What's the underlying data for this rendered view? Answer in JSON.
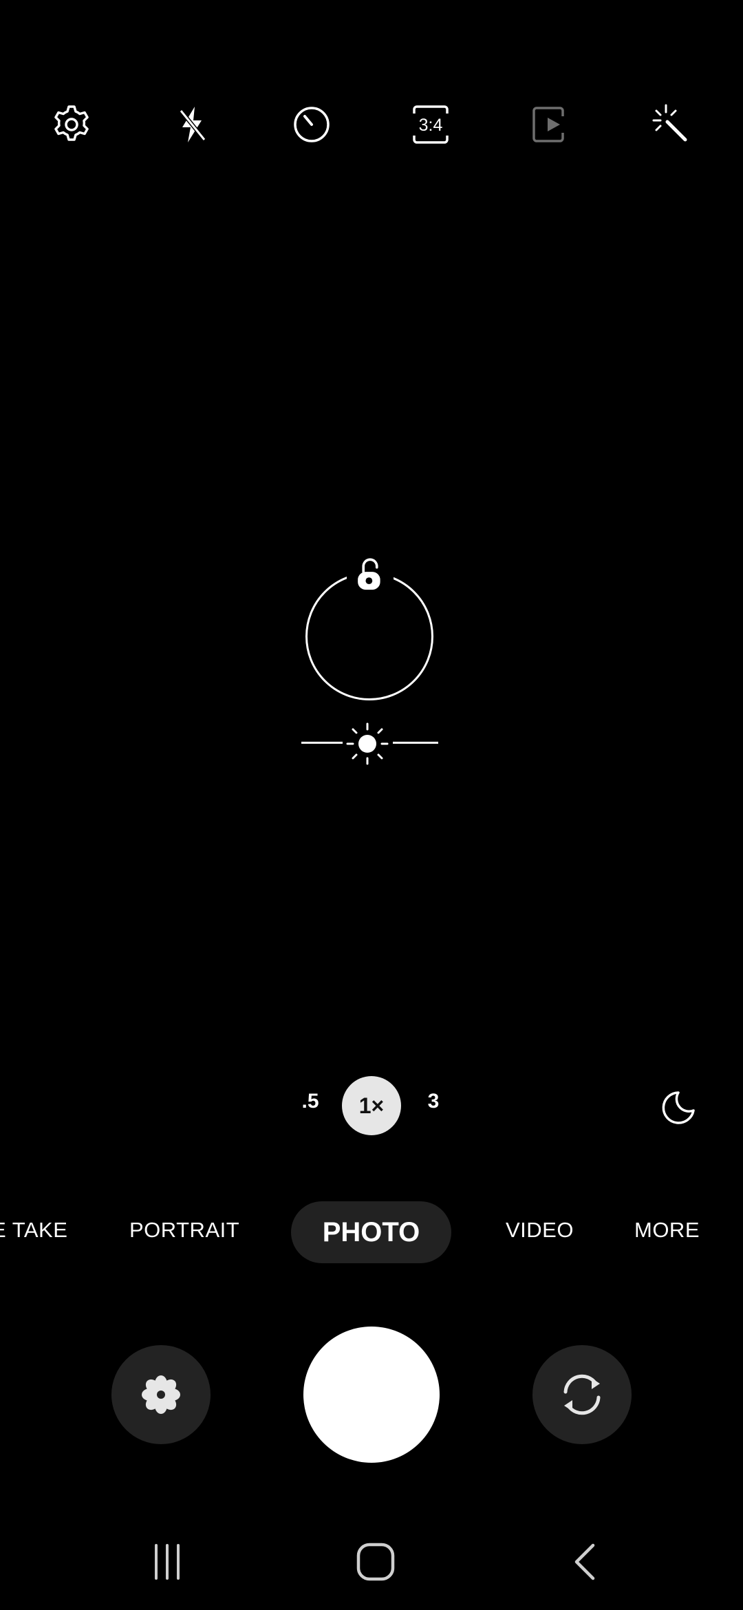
{
  "toolbar": {
    "icons": [
      "settings-icon",
      "flash-off-icon",
      "timer-icon",
      "aspect-ratio-icon",
      "motion-photo-icon",
      "filters-icon"
    ],
    "ratio_label": "3:4"
  },
  "zoom": {
    "options": [
      ".5",
      "1×",
      "3"
    ],
    "selected": "1×"
  },
  "modes": {
    "items": [
      "E TAKE",
      "PORTRAIT",
      "PHOTO",
      "VIDEO",
      "MORE"
    ],
    "selected": "PHOTO"
  },
  "colors": {
    "background": "#000000",
    "button_bg": "#232323",
    "zoom_active_bg": "#e6e6e6",
    "mode_active_bg": "#222222"
  }
}
